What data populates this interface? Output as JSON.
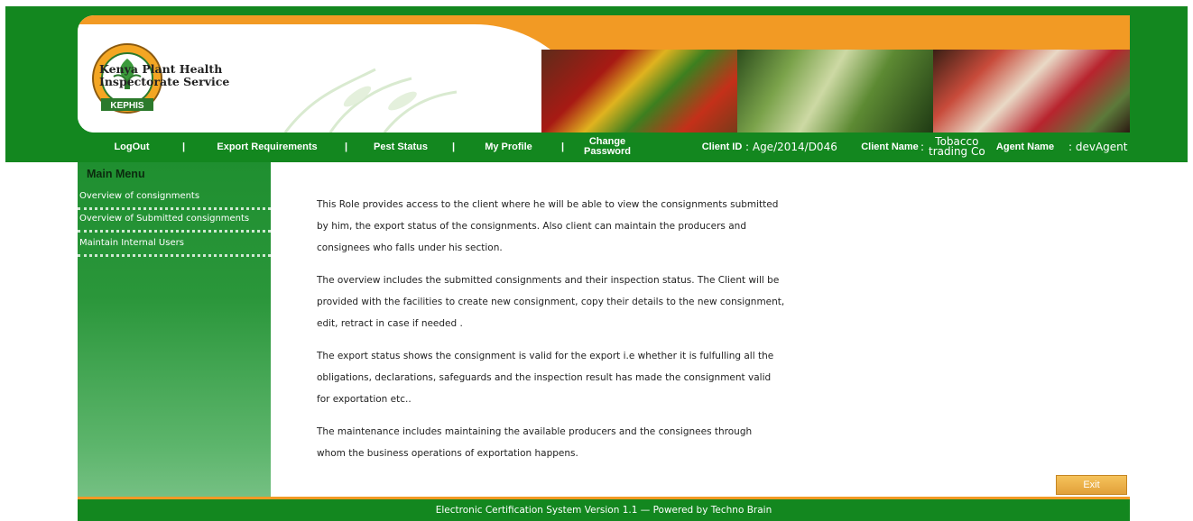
{
  "header": {
    "org_name_line1": "Kenya Plant Health",
    "org_name_line2": "Inspectorate Service",
    "logo_text": "KEPHIS",
    "logo_ring_text": "KENYA PLANT HEALTH INSPECTORATE SERVICE",
    "colors": {
      "green": "#13871f",
      "orange": "#f29a24"
    }
  },
  "nav": {
    "logout": "LogOut",
    "sep": "|",
    "export_requirements": "Export Requirements",
    "pest_status": "Pest Status",
    "my_profile": "My Profile",
    "change_password_line1": "Change",
    "change_password_line2": "Password",
    "client_id_label": "Client ID",
    "client_id_value": ": Age/2014/D046",
    "client_name_label": "Client Name",
    "client_name_colon": ":",
    "client_name_line1": "Tobacco",
    "client_name_line2": "trading Co",
    "agent_name_label": "Agent Name",
    "agent_name_value": ": devAgent"
  },
  "sidebar": {
    "title": "Main Menu",
    "items": [
      {
        "label": "Overview of consignments"
      },
      {
        "label": "Overview of Submitted consignments"
      },
      {
        "label": "Maintain Internal Users"
      }
    ]
  },
  "main": {
    "paragraphs": [
      {
        "lines": [
          "This Role provides access to the client where he will be able to view the consignments submitted",
          "by him, the export status of the consignments. Also client can maintain the producers and",
          "consignees who falls under his section."
        ]
      },
      {
        "lines": [
          "The overview includes the submitted consignments and their inspection status. The Client will be",
          "provided with the facilities to create new consignment, copy their details to the new consignment,",
          "edit, retract in case if needed ."
        ]
      },
      {
        "lines": [
          "The export status shows the consignment is valid for the export i.e whether it is fulfulling all the",
          "obligations, declarations, safeguards and the inspection result has made the consignment valid",
          "for exportation etc.."
        ]
      },
      {
        "lines": [
          "The maintenance includes maintaining the available producers and the consignees through",
          "whom the business operations of exportation happens."
        ]
      }
    ]
  },
  "exit_label": "Exit",
  "footer": {
    "text": "Electronic Certification System Version 1.1 — Powered by Techno Brain"
  }
}
